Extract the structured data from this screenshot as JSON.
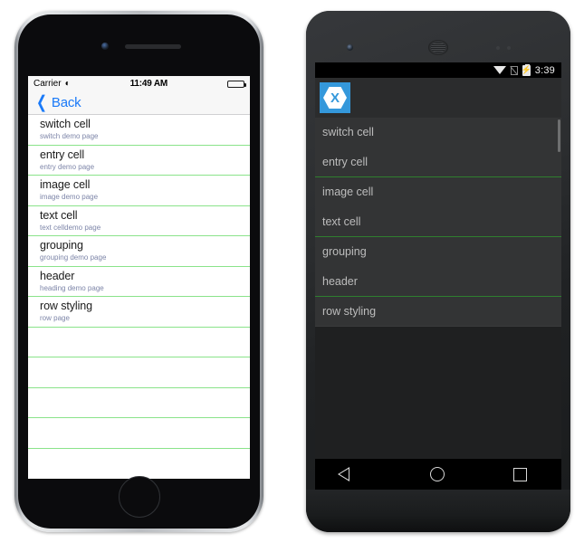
{
  "iphone": {
    "status_bar": {
      "carrier": "Carrier",
      "wifi_icon": "wifi-icon",
      "time": "11:49 AM",
      "battery_icon": "battery-full-icon"
    },
    "nav_bar": {
      "back_chevron_icon": "chevron-left-icon",
      "back_label": "Back"
    },
    "rows": [
      {
        "title": "switch cell",
        "subtitle": "switch demo page"
      },
      {
        "title": "entry cell",
        "subtitle": "entry demo page"
      },
      {
        "title": "image cell",
        "subtitle": "image demo page"
      },
      {
        "title": "text cell",
        "subtitle": "text celldemo page"
      },
      {
        "title": "grouping",
        "subtitle": "grouping demo page"
      },
      {
        "title": "header",
        "subtitle": "heading demo page"
      },
      {
        "title": "row styling",
        "subtitle": "row page"
      }
    ],
    "empty_row_count": 4,
    "colors": {
      "separator": "#8ae38a",
      "accent": "#1a7af8",
      "title": "#1b1b1b",
      "subtitle": "#7d85a8",
      "chrome": "#f7f7f7"
    }
  },
  "android": {
    "status_bar": {
      "wifi_icon": "wifi-icon",
      "sim_icon": "no-sim-icon",
      "battery_icon": "battery-charging-icon",
      "time": "3:39"
    },
    "action_bar": {
      "app_icon": "xamarin-logo-icon"
    },
    "rows": [
      {
        "title": "switch cell",
        "separator": "none"
      },
      {
        "title": "entry cell",
        "separator": "green"
      },
      {
        "title": "image cell",
        "separator": "none"
      },
      {
        "title": "text cell",
        "separator": "green"
      },
      {
        "title": "grouping",
        "separator": "none"
      },
      {
        "title": "header",
        "separator": "green"
      },
      {
        "title": "row styling",
        "separator": "faint"
      }
    ],
    "nav_bar": {
      "back_icon": "triangle-back-icon",
      "home_icon": "circle-home-icon",
      "recents_icon": "square-recents-icon"
    },
    "colors": {
      "separator_green": "#2f7f2f",
      "list_bg": "#333435",
      "action_bar_bg": "#2b2c2d",
      "text": "#bdbdbd",
      "brand": "#3498db"
    }
  }
}
